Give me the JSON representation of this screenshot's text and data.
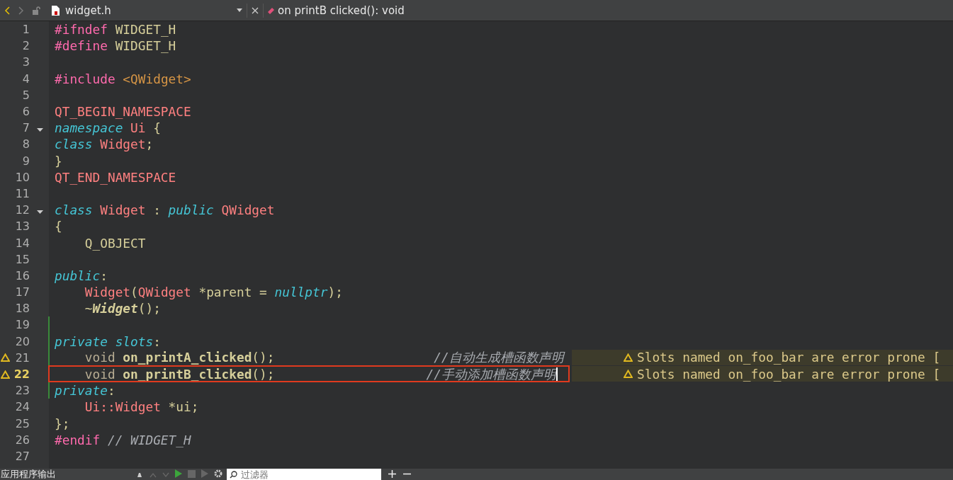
{
  "toolbar": {
    "file_name": "widget.h",
    "symbol": "on printB clicked(): void"
  },
  "editor": {
    "lines": [
      {
        "number": "1",
        "tokens": [
          {
            "text": "#ifndef ",
            "kind": "pre"
          },
          {
            "text": "WIDGET_H",
            "kind": "plain"
          }
        ]
      },
      {
        "number": "2",
        "tokens": [
          {
            "text": "#define ",
            "kind": "pre"
          },
          {
            "text": "WIDGET_H",
            "kind": "plain"
          }
        ]
      },
      {
        "number": "3"
      },
      {
        "number": "4",
        "tokens": [
          {
            "text": "#include ",
            "kind": "pre"
          },
          {
            "text": "<QWidget>",
            "kind": "str"
          }
        ]
      },
      {
        "number": "5"
      },
      {
        "number": "6",
        "tokens": [
          {
            "text": "QT_BEGIN_NAMESPACE",
            "kind": "type"
          }
        ]
      },
      {
        "number": "7",
        "fold": true,
        "tokens": [
          {
            "text": "namespace ",
            "kind": "kw"
          },
          {
            "text": "Ui ",
            "kind": "type"
          },
          {
            "text": "{",
            "kind": "plain"
          }
        ]
      },
      {
        "number": "8",
        "tokens": [
          {
            "text": "class ",
            "kind": "kw"
          },
          {
            "text": "Widget",
            "kind": "type"
          },
          {
            "text": ";",
            "kind": "plain"
          }
        ]
      },
      {
        "number": "9",
        "tokens": [
          {
            "text": "}",
            "kind": "plain"
          }
        ]
      },
      {
        "number": "10",
        "tokens": [
          {
            "text": "QT_END_NAMESPACE",
            "kind": "type"
          }
        ]
      },
      {
        "number": "11"
      },
      {
        "number": "12",
        "fold": true,
        "tokens": [
          {
            "text": "class ",
            "kind": "kw"
          },
          {
            "text": "Widget ",
            "kind": "type"
          },
          {
            "text": ": ",
            "kind": "plain"
          },
          {
            "text": "public ",
            "kind": "kw"
          },
          {
            "text": "QWidget",
            "kind": "type"
          }
        ]
      },
      {
        "number": "13",
        "tokens": [
          {
            "text": "{",
            "kind": "plain"
          }
        ]
      },
      {
        "number": "14",
        "tokens": [
          {
            "text": "    Q_OBJECT",
            "kind": "plain"
          }
        ]
      },
      {
        "number": "15"
      },
      {
        "number": "16",
        "tokens": [
          {
            "text": "public",
            "kind": "kw"
          },
          {
            "text": ":",
            "kind": "plain"
          }
        ]
      },
      {
        "number": "17",
        "tokens": [
          {
            "text": "    Widget",
            "kind": "type"
          },
          {
            "text": "(",
            "kind": "plain"
          },
          {
            "text": "QWidget ",
            "kind": "type"
          },
          {
            "text": "*parent = ",
            "kind": "plain"
          },
          {
            "text": "nullptr",
            "kind": "kw"
          },
          {
            "text": ");",
            "kind": "plain"
          }
        ]
      },
      {
        "number": "18",
        "tokens": [
          {
            "text": "    ~",
            "kind": "plain"
          },
          {
            "text": "Widget",
            "kind": "dtor"
          },
          {
            "text": "();",
            "kind": "plain"
          }
        ]
      },
      {
        "number": "19",
        "changed": true
      },
      {
        "number": "20",
        "changed": true,
        "tokens": [
          {
            "text": "private slots",
            "kind": "kw"
          },
          {
            "text": ":",
            "kind": "plain"
          }
        ]
      },
      {
        "number": "21",
        "changed": true,
        "warning": "Slots named on_foo_bar are error prone [",
        "tokens": [
          {
            "text": "    void ",
            "kind": "void"
          },
          {
            "text": "on_printA_clicked",
            "kind": "fn"
          },
          {
            "text": "();                     ",
            "kind": "plain"
          },
          {
            "text": "//自动生成槽函数声明",
            "kind": "cmt"
          }
        ]
      },
      {
        "number": "22",
        "current": true,
        "changed": true,
        "marked": true,
        "cursor": true,
        "warning": "Slots named on_foo_bar are error prone [",
        "tokens": [
          {
            "text": "    void ",
            "kind": "void"
          },
          {
            "text": "on_printB_clicked",
            "kind": "fn"
          },
          {
            "text": "();                    ",
            "kind": "plain"
          },
          {
            "text": "//手动添加槽函数声明",
            "kind": "cmt"
          }
        ]
      },
      {
        "number": "23",
        "changed": true,
        "tokens": [
          {
            "text": "private",
            "kind": "kw"
          },
          {
            "text": ":",
            "kind": "plain"
          }
        ]
      },
      {
        "number": "24",
        "tokens": [
          {
            "text": "    Ui::Widget ",
            "kind": "type"
          },
          {
            "text": "*ui;",
            "kind": "plain"
          }
        ]
      },
      {
        "number": "25",
        "tokens": [
          {
            "text": "};",
            "kind": "plain"
          }
        ]
      },
      {
        "number": "26",
        "tokens": [
          {
            "text": "#endif ",
            "kind": "pre"
          },
          {
            "text": "// WIDGET_H",
            "kind": "cmt"
          }
        ]
      },
      {
        "number": "27"
      }
    ]
  },
  "output_pane": {
    "title": "应用程序输出",
    "filter": {
      "placeholder": "过滤器"
    }
  }
}
